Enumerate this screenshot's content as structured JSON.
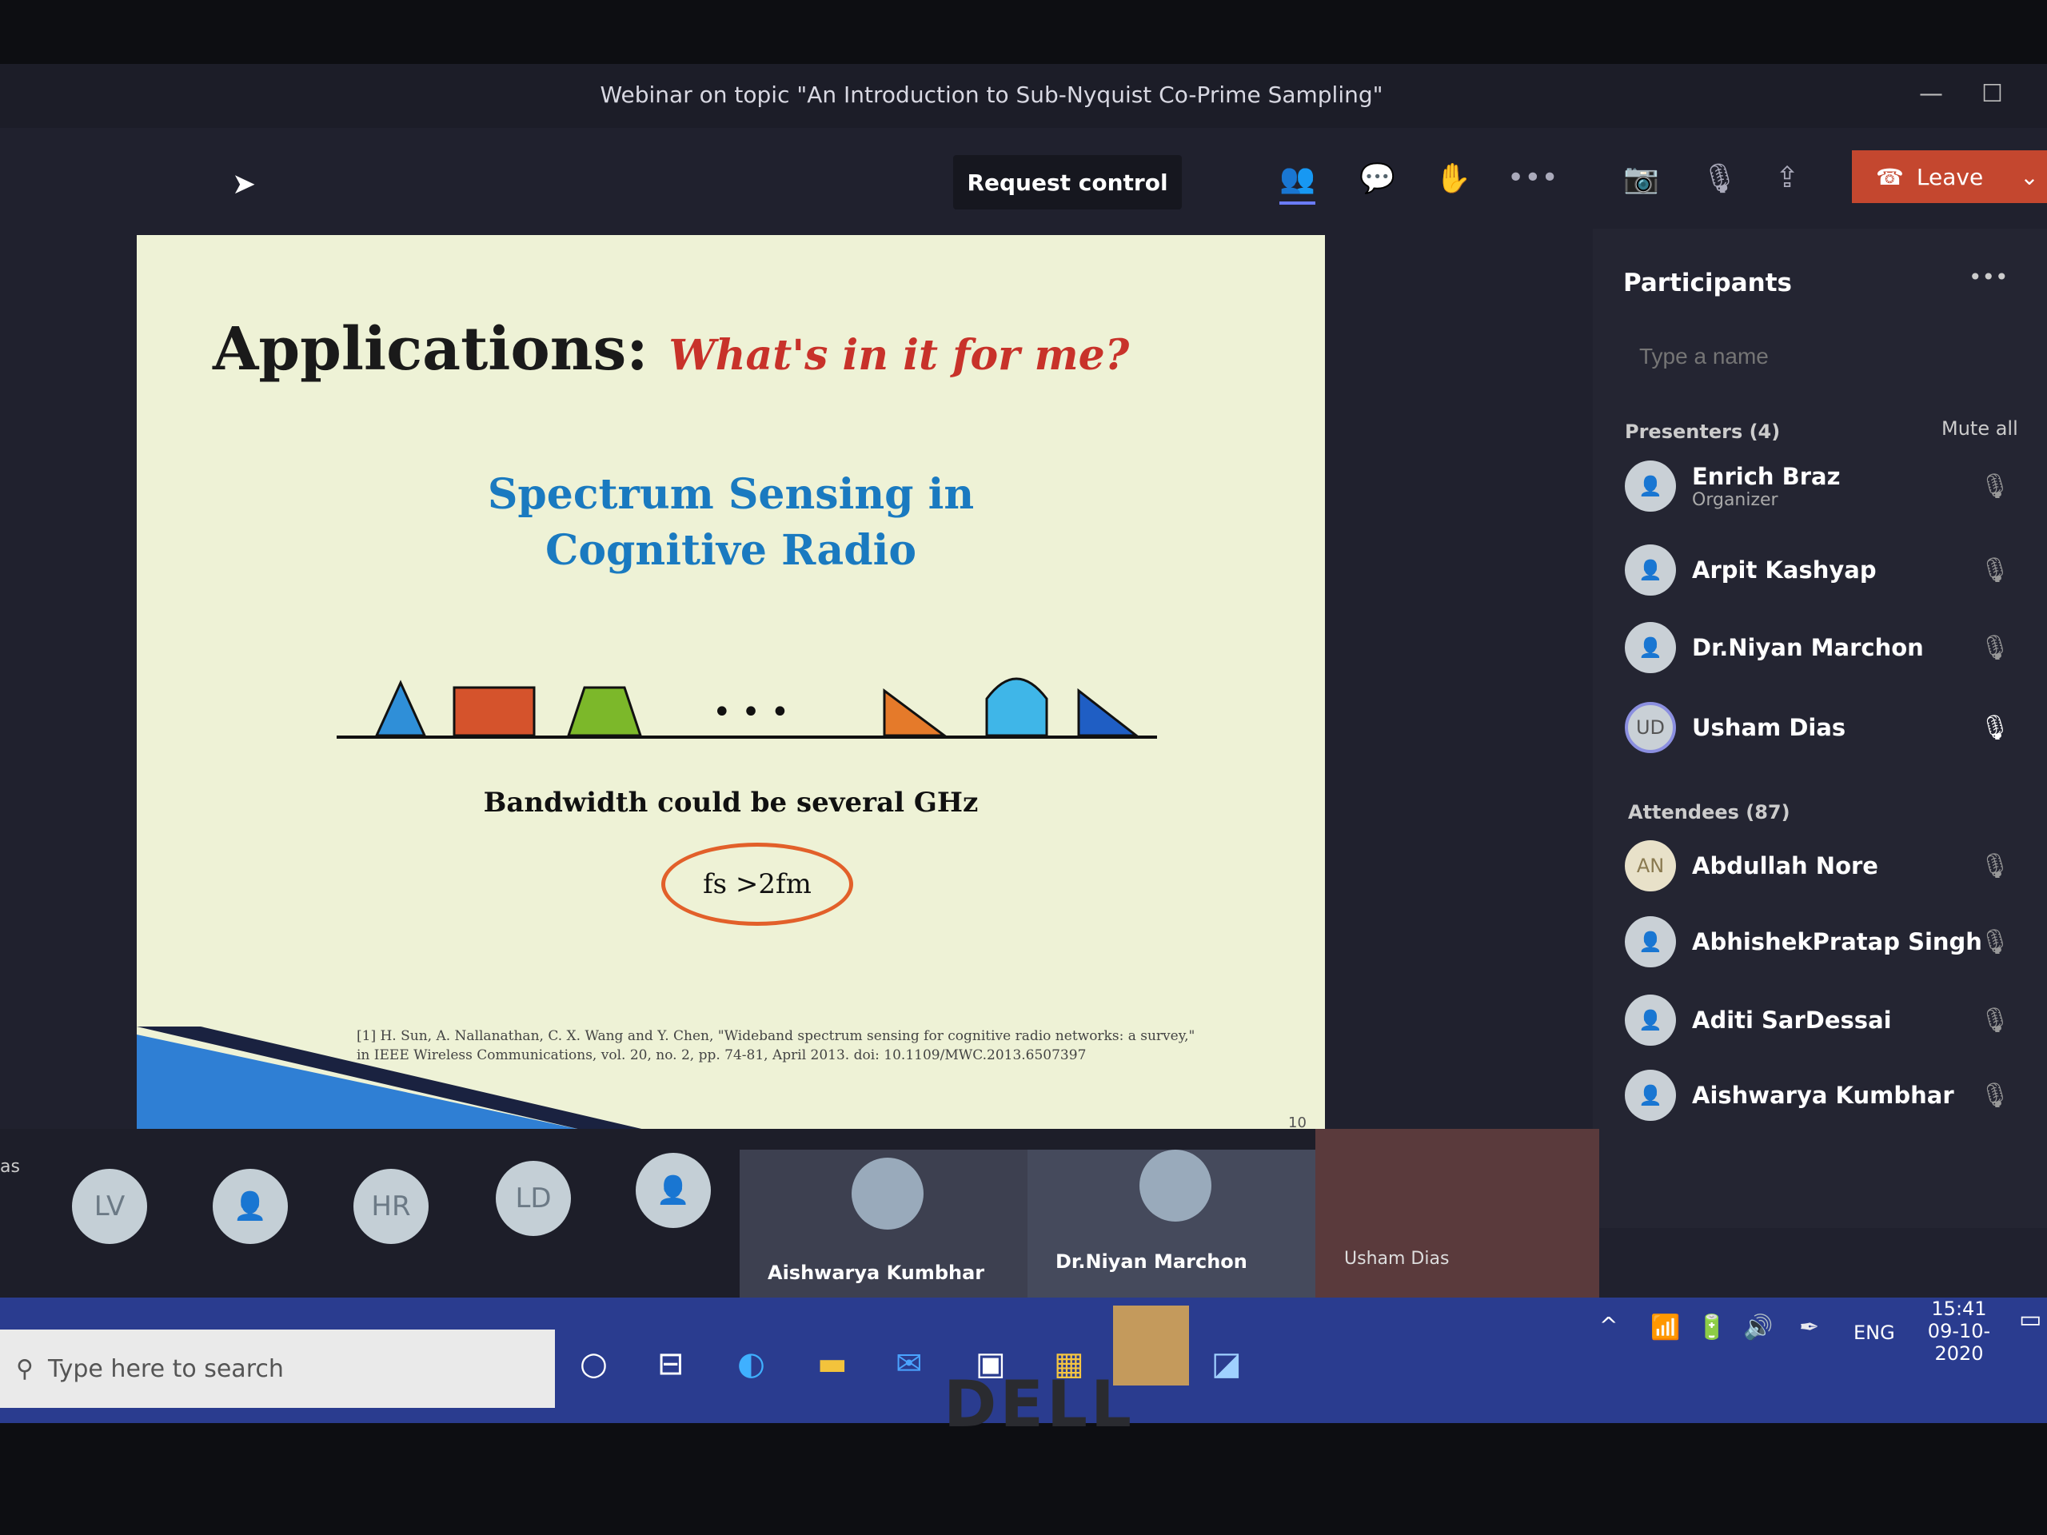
{
  "window": {
    "title": "Webinar on topic \"An Introduction to Sub-Nyquist Co-Prime Sampling\"",
    "minimize": "—",
    "maximize": "☐"
  },
  "toolbar": {
    "request_control": "Request control",
    "more": "•••",
    "leave": "Leave"
  },
  "slide": {
    "title": "Applications:",
    "subtitle": "What's in it for me?",
    "heading_line1": "Spectrum Sensing in",
    "heading_line2": "Cognitive Radio",
    "dots": "• • •",
    "bandwidth": "Bandwidth could be several GHz",
    "formula": "fs >2fm",
    "ref_line1": "[1] H. Sun, A. Nallanathan, C. X. Wang and Y. Chen, \"Wideband spectrum sensing for cognitive radio networks: a survey,\"",
    "ref_line2": "in IEEE Wireless Communications, vol. 20, no. 2, pp. 74-81, April 2013. doi: 10.1109/MWC.2013.6507397",
    "page": "10"
  },
  "participants": {
    "title": "Participants",
    "more": "•••",
    "search_placeholder": "Type a name",
    "presenters_label": "Presenters (4)",
    "mute_all": "Mute all",
    "presenters": [
      {
        "name": "Enrich Braz",
        "role": "Organizer"
      },
      {
        "name": "Arpit Kashyap"
      },
      {
        "name": "Dr.Niyan Marchon"
      },
      {
        "name": "Usham Dias",
        "initials": "UD"
      }
    ],
    "attendees_label": "Attendees (87)",
    "attendees": [
      {
        "name": "Abdullah Nore",
        "initials": "AN"
      },
      {
        "name": "AbhishekPratap Singh"
      },
      {
        "name": "Aditi SarDessai"
      },
      {
        "name": "Aishwarya Kumbhar"
      }
    ]
  },
  "strip": {
    "left_label": "as",
    "avatars": [
      "LV",
      "",
      "HR",
      "LD",
      ""
    ],
    "videos": [
      {
        "name": "Aishwarya Kumbhar"
      },
      {
        "name": "Dr.Niyan Marchon"
      },
      {
        "name": "Usham Dias"
      }
    ]
  },
  "taskbar": {
    "search_placeholder": "Type here to search",
    "lang": "ENG",
    "time": "15:41",
    "date": "09-10-2020"
  },
  "bezel": {
    "logo": "DELL"
  }
}
